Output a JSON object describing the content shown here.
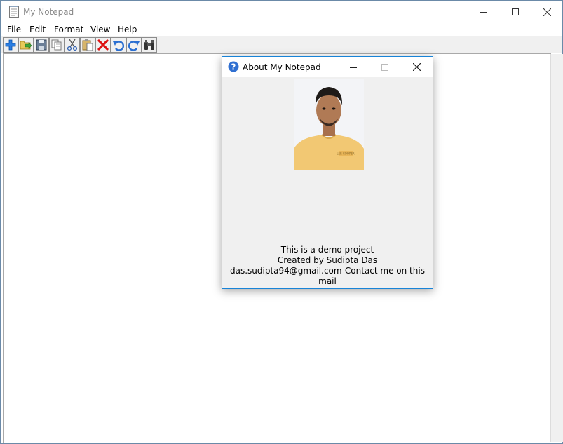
{
  "window": {
    "title": "My Notepad"
  },
  "menu": {
    "items": [
      "File",
      "Edit",
      "Format",
      "View",
      "Help"
    ]
  },
  "toolbar": {
    "buttons": [
      "new-icon",
      "open-icon",
      "save-icon",
      "copy-icon",
      "cut-icon",
      "paste-icon",
      "delete-icon",
      "undo-icon",
      "redo-icon",
      "find-icon"
    ]
  },
  "editor": {
    "text": ""
  },
  "about_dialog": {
    "title": "About My Notepad",
    "lines": [
      "This is a demo project",
      "Created by Sudipta Das",
      "das.sudipta94@gmail.com-Contact me on this mail"
    ],
    "photo_shirt_text": "LEE COOPER"
  },
  "colors": {
    "accent_border": "#1883d7",
    "toolbar_bg": "#f0f0f0",
    "dialog_bg": "#f0f0f0",
    "help_icon": "#2f6fd1"
  }
}
